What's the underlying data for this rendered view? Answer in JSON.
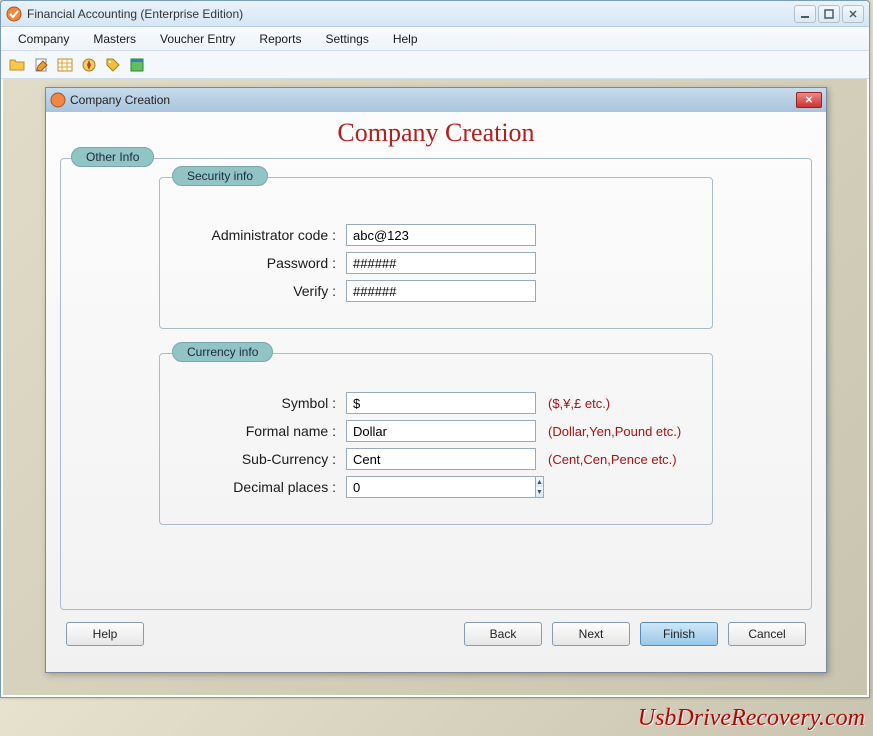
{
  "app": {
    "title": "Financial Accounting (Enterprise Edition)"
  },
  "menubar": {
    "items": [
      "Company",
      "Masters",
      "Voucher Entry",
      "Reports",
      "Settings",
      "Help"
    ]
  },
  "toolbar": {
    "icons": [
      "folder-icon",
      "edit-icon",
      "table-icon",
      "compass-icon",
      "tag-icon",
      "window-icon"
    ]
  },
  "dialog": {
    "title": "Company Creation",
    "heading": "Company Creation",
    "outer_legend": "Other Info",
    "security": {
      "legend": "Security info",
      "admin_label": "Administrator code :",
      "admin_value": "abc@123",
      "password_label": "Password :",
      "password_value": "######",
      "verify_label": "Verify :",
      "verify_value": "######"
    },
    "currency": {
      "legend": "Currency info",
      "symbol_label": "Symbol :",
      "symbol_value": "$",
      "symbol_hint": "($,¥,£ etc.)",
      "formal_label": "Formal name :",
      "formal_value": "Dollar",
      "formal_hint": "(Dollar,Yen,Pound etc.)",
      "sub_label": "Sub-Currency :",
      "sub_value": "Cent",
      "sub_hint": "(Cent,Cen,Pence etc.)",
      "decimal_label": "Decimal places :",
      "decimal_value": "0"
    },
    "buttons": {
      "help": "Help",
      "back": "Back",
      "next": "Next",
      "finish": "Finish",
      "cancel": "Cancel"
    }
  },
  "watermark": "UsbDriveRecovery.com"
}
